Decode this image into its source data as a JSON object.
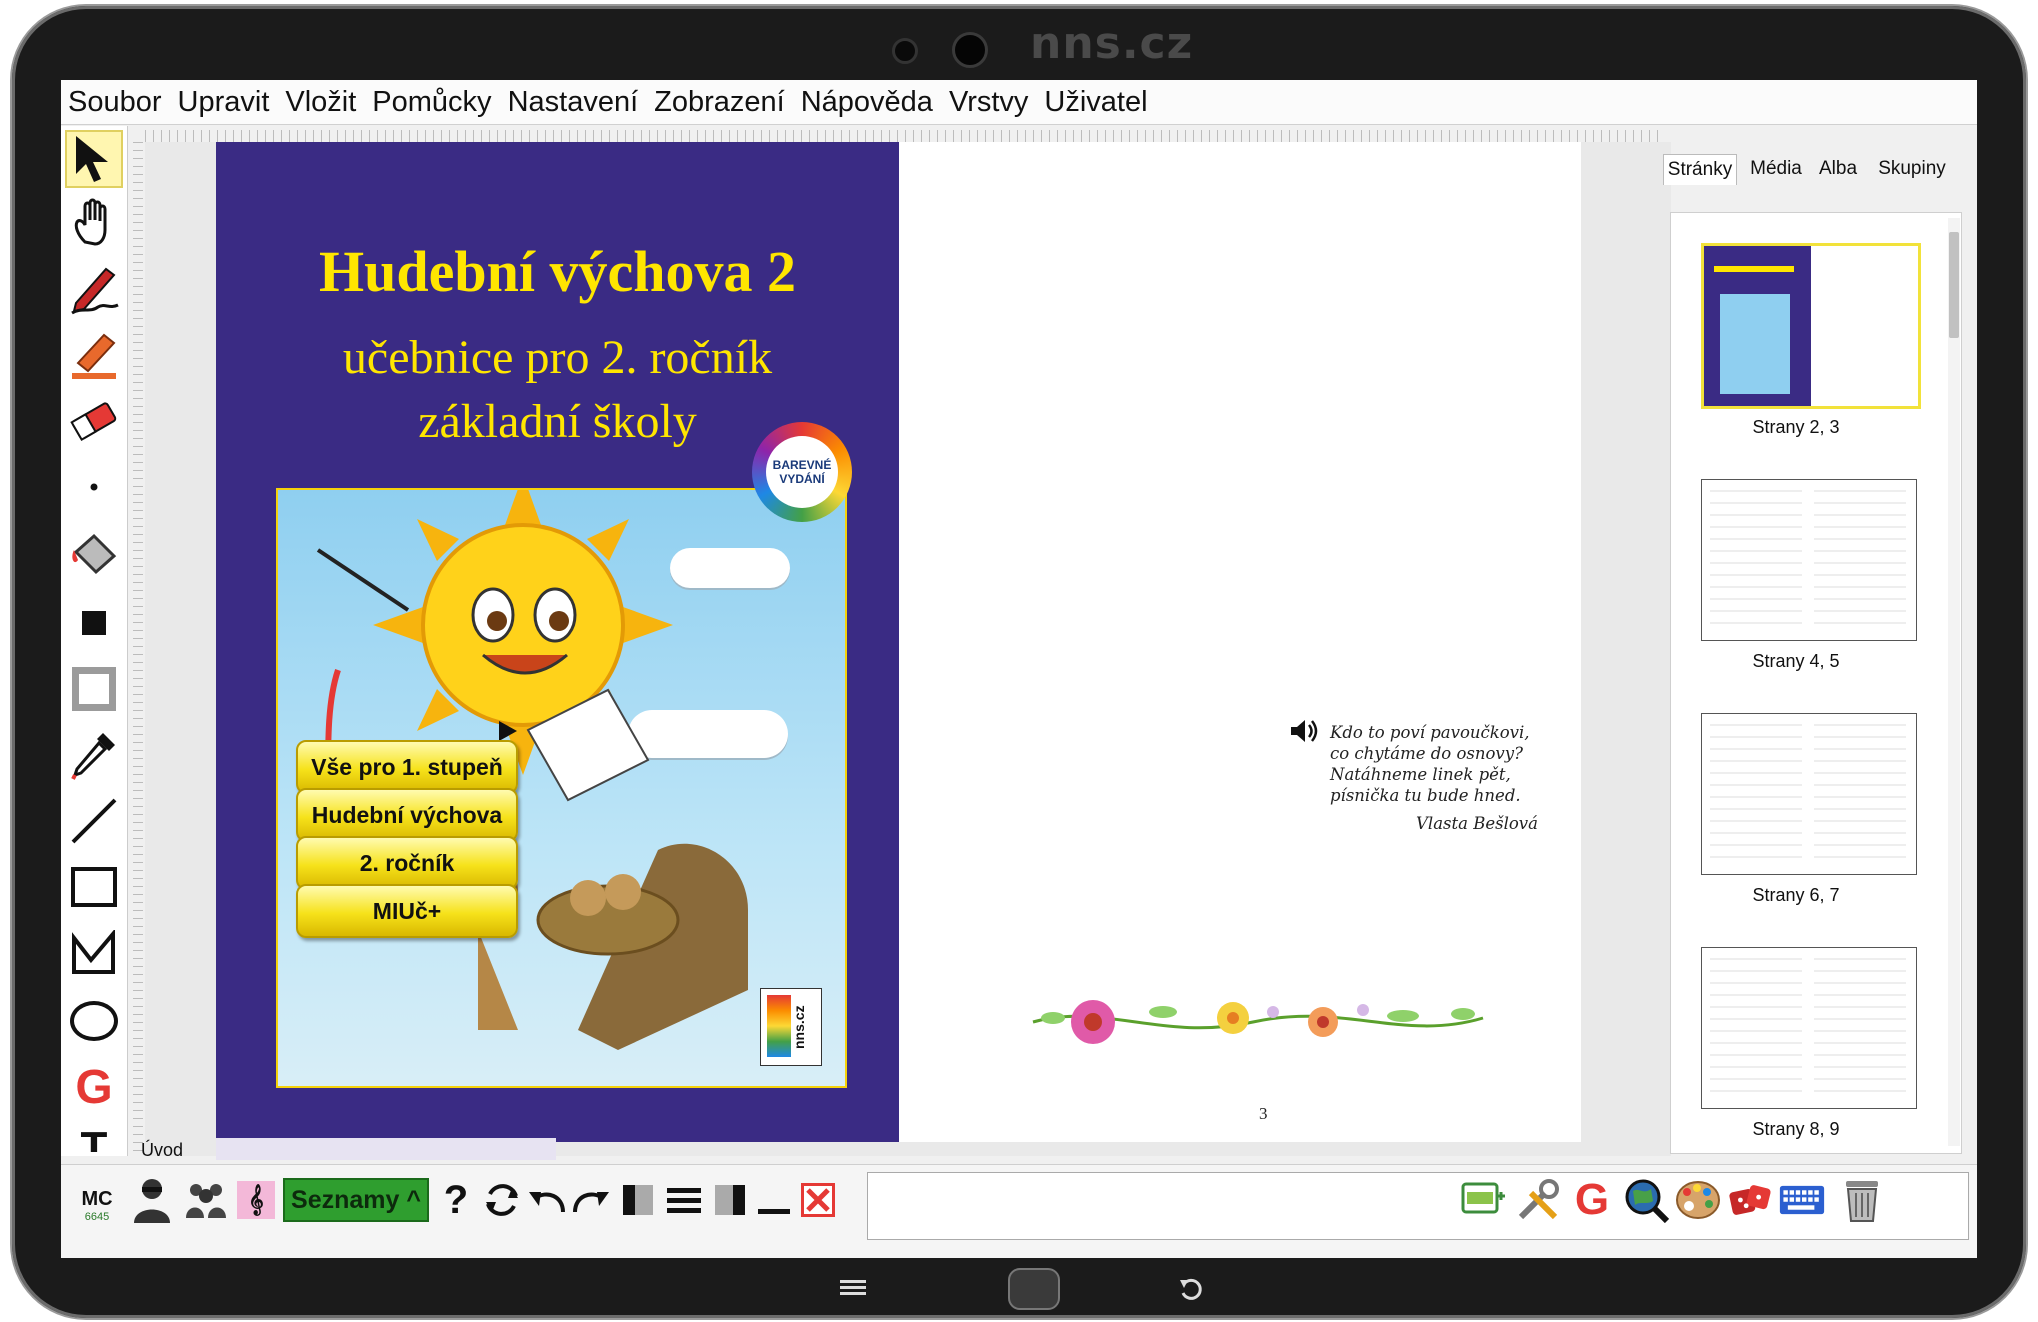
{
  "device": {
    "brand": "nns.cz"
  },
  "menu": [
    "Soubor",
    "Upravit",
    "Vložit",
    "Pomůcky",
    "Nastavení",
    "Zobrazení",
    "Nápověda",
    "Vrstvy",
    "Uživatel"
  ],
  "cover": {
    "title": "Hudební výchova 2",
    "subtitle_line1": "učebnice pro 2. ročník",
    "subtitle_line2": "základní školy",
    "badge_line1": "BAREVNÉ",
    "badge_line2": "VYDÁNÍ",
    "buttons": [
      "Vše pro 1. stupeň",
      "Hudební výchova",
      "2. ročník",
      "MIUč+"
    ],
    "publisher_logo": "nns.cz"
  },
  "right_page": {
    "poem": [
      "Kdo to poví pavoučkovi,",
      "co chytáme do osnovy?",
      "Natáhneme linek pět,",
      "písnička tu bude hned."
    ],
    "author": "Vlasta Bešlová",
    "page_number": "3"
  },
  "sidebar": {
    "tabs": [
      "Stránky",
      "Média",
      "Alba",
      "Skupiny"
    ],
    "active_tab": "Stránky",
    "thumbnails": [
      "Strany 2, 3",
      "Strany 4, 5",
      "Strany 6, 7",
      "Strany 8, 9"
    ]
  },
  "status": {
    "tab_label": "Úvod"
  },
  "bottom": {
    "mc_label": "MC",
    "mc_number": "6645",
    "lists_button": "Seznamy ^",
    "help": "?"
  },
  "colors": {
    "cover_bg": "#3a2b84",
    "title_yellow": "#ffe600",
    "lists_green": "#2f9e2f",
    "bezel": "#1b1b1b"
  }
}
